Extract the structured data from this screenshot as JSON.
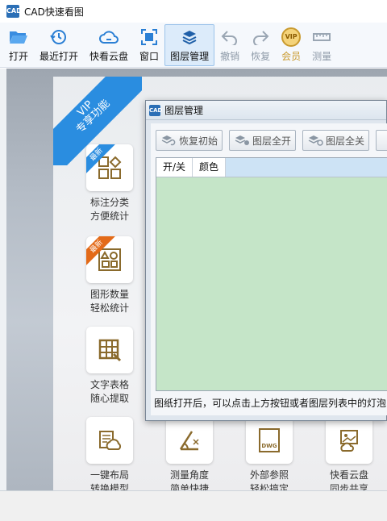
{
  "window": {
    "title": "CAD快速看图",
    "logo_text": "CAD"
  },
  "toolbar": {
    "open": "打开",
    "recent": "最近打开",
    "cloud": "快看云盘",
    "window": "窗口",
    "layers": "图层管理",
    "undo": "撤销",
    "redo": "恢复",
    "vip": "会员",
    "vip_icon_text": "VIP",
    "measure": "测量"
  },
  "vip_panel": {
    "ribbon_line1": "VIP",
    "ribbon_line2": "专享功能",
    "features": [
      {
        "line1": "标注分类",
        "line2": "方便统计",
        "badge": "最新"
      },
      {
        "line1": "图形数量",
        "line2": "轻松统计",
        "badge": "最新"
      },
      {
        "line1": "文字表格",
        "line2": "随心提取"
      },
      {
        "line1": "一键布局",
        "line2": "转换模型"
      },
      {
        "line1": "测量角度",
        "line2": "简单快捷"
      },
      {
        "line1": "外部参照",
        "line2": "轻松搞定",
        "icon_text": "DWG"
      },
      {
        "line1": "快看云盘",
        "line2": "同步共享"
      }
    ]
  },
  "layer_dialog": {
    "title": "图层管理",
    "buttons": {
      "reset": "恢复初始",
      "all_on": "图层全开",
      "all_off": "图层全关"
    },
    "columns": {
      "onoff": "开/关",
      "color": "颜色"
    },
    "tip": "图纸打开后，可以点击上方按钮或者图层列表中的灯泡"
  },
  "colors": {
    "accent": "#2a8de0",
    "badge_orange": "#e36a18",
    "vip_gold": "#c99a2e",
    "icon_brown": "#8a6a2c",
    "grid_green": "#c5e5c8"
  }
}
